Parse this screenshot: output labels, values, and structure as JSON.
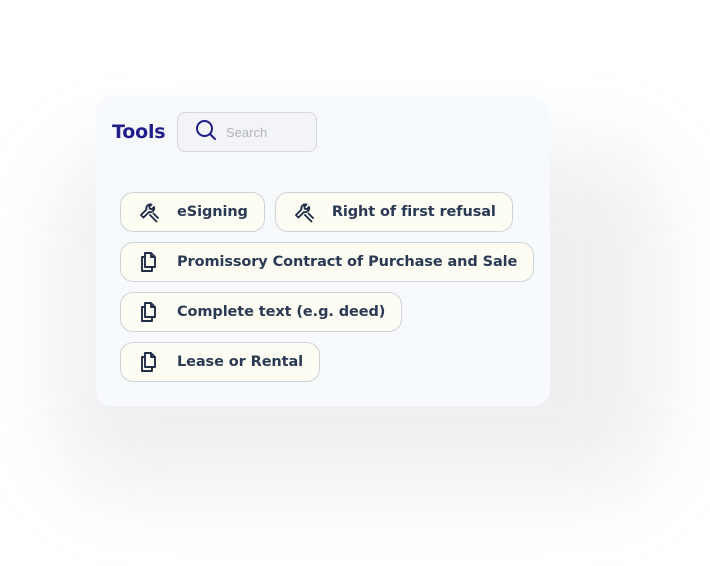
{
  "panel": {
    "title": "Tools",
    "search": {
      "placeholder": "Search",
      "value": "",
      "icon": "search-icon"
    }
  },
  "tools": [
    {
      "label": "eSigning",
      "icon": "wrench-icon"
    },
    {
      "label": "Right of first refusal",
      "icon": "wrench-icon"
    },
    {
      "label": "Promissory Contract of Purchase and Sale",
      "icon": "documents-icon"
    },
    {
      "label": "Complete text (e.g. deed)",
      "icon": "documents-icon"
    },
    {
      "label": "Lease or Rental",
      "icon": "documents-icon"
    }
  ],
  "colors": {
    "title": "#1f1e8a",
    "chip_background": "#fdfdf3",
    "chip_border": "#cdd3d8",
    "chip_text": "#2a3a55",
    "card_background": "#f7fafd",
    "search_icon": "#1f1e8a"
  }
}
